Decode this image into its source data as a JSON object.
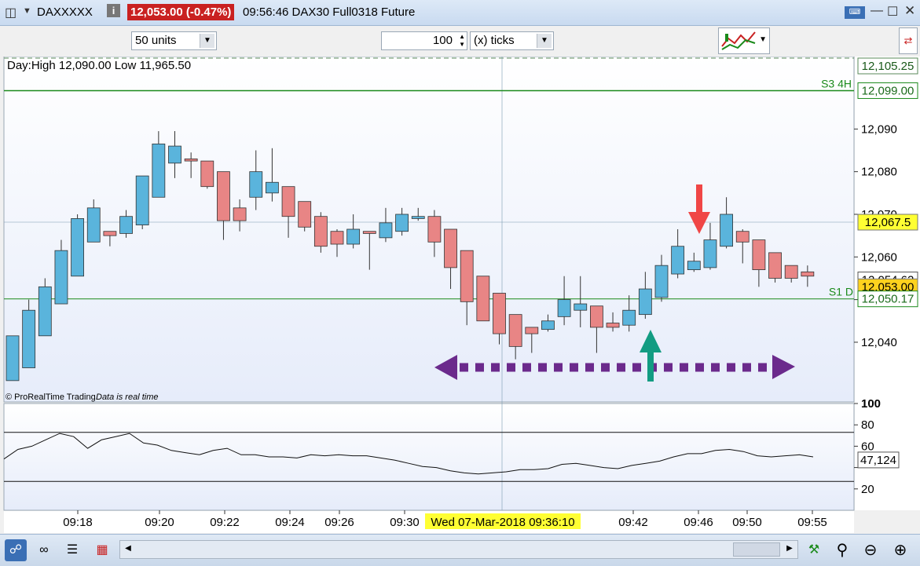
{
  "window": {
    "symbol": "DAXXXXX",
    "price_badge": "12,053.00 (-0.47%)",
    "info": "09:56:46 DAX30 Full0318 Future"
  },
  "toolbar": {
    "units_select": "50 units",
    "ticks_value": "100",
    "ticks_select": "(x) ticks"
  },
  "chart_data": [
    {
      "type": "candlestick",
      "title": "Day:High 12,090.00 Low 11,965.50",
      "footer_brand": "© ProRealTime Trading",
      "footer_note": "Data is real time",
      "ylim": [
        12026,
        12107
      ],
      "y_ticks": [
        12040,
        12050,
        12060,
        12070,
        12080,
        12090
      ],
      "y_tick_labels": [
        "12,040",
        "12,050",
        "12,060",
        "12,070",
        "12,080",
        "12,090"
      ],
      "x_tick_labels": [
        "09:18",
        "09:20",
        "09:22",
        "09:24",
        "09:26",
        "09:30",
        "09:42",
        "09:46",
        "09:50",
        "09:55"
      ],
      "crosshair_label": "Wed 07-Mar-2018 09:36:10",
      "crosshair_price": "12,067.5",
      "current_price": "12,053.00",
      "price_labels": [
        "12,105.25",
        "12,054.62",
        "12,050.17"
      ],
      "levels": [
        {
          "name": "S3 4H",
          "value": 12099.0,
          "label": "12,099.00",
          "color": "#1a8a1a"
        },
        {
          "name": "S1 D",
          "value": 12050.17,
          "label": "12,050.17",
          "color": "#1a8a1a"
        }
      ],
      "colors": {
        "up": "#5ab4dc",
        "down": "#e88585",
        "arrow_down": "#f04646",
        "arrow_up": "#129c82",
        "range": "#6b2a8c"
      },
      "candles": [
        {
          "o": 12031.0,
          "h": 12038.0,
          "l": 12031.0,
          "c": 12041.5
        },
        {
          "o": 12034.0,
          "h": 12050.0,
          "l": 12034.0,
          "c": 12047.5
        },
        {
          "o": 12041.5,
          "h": 12055.0,
          "l": 12041.5,
          "c": 12053.0
        },
        {
          "o": 12049.0,
          "h": 12064.0,
          "l": 12049.0,
          "c": 12061.5
        },
        {
          "o": 12055.5,
          "h": 12070.0,
          "l": 12055.5,
          "c": 12069.0
        },
        {
          "o": 12063.5,
          "h": 12073.5,
          "l": 12063.5,
          "c": 12071.5
        },
        {
          "o": 12066.0,
          "h": 12066.0,
          "l": 12062.5,
          "c": 12065.0
        },
        {
          "o": 12065.5,
          "h": 12071.0,
          "l": 12064.5,
          "c": 12069.5
        },
        {
          "o": 12067.5,
          "h": 12077.5,
          "l": 12066.5,
          "c": 12079.0
        },
        {
          "o": 12074.0,
          "h": 12089.5,
          "l": 12074.0,
          "c": 12086.5
        },
        {
          "o": 12082.0,
          "h": 12089.5,
          "l": 12078.5,
          "c": 12086.0
        },
        {
          "o": 12083.0,
          "h": 12084.5,
          "l": 12078.5,
          "c": 12082.5
        },
        {
          "o": 12082.5,
          "h": 12082.5,
          "l": 12076.0,
          "c": 12076.5
        },
        {
          "o": 12080.0,
          "h": 12080.0,
          "l": 12064.0,
          "c": 12068.5
        },
        {
          "o": 12071.5,
          "h": 12073.5,
          "l": 12066.0,
          "c": 12068.5
        },
        {
          "o": 12074.0,
          "h": 12085.0,
          "l": 12071.0,
          "c": 12080.0
        },
        {
          "o": 12075.0,
          "h": 12085.5,
          "l": 12073.0,
          "c": 12077.5
        },
        {
          "o": 12076.5,
          "h": 12076.5,
          "l": 12064.5,
          "c": 12069.5
        },
        {
          "o": 12073.0,
          "h": 12073.0,
          "l": 12066.0,
          "c": 12067.0
        },
        {
          "o": 12069.5,
          "h": 12070.5,
          "l": 12061.0,
          "c": 12062.5
        },
        {
          "o": 12066.0,
          "h": 12066.5,
          "l": 12060.0,
          "c": 12063.0
        },
        {
          "o": 12063.0,
          "h": 12070.0,
          "l": 12062.0,
          "c": 12066.5
        },
        {
          "o": 12066.0,
          "h": 12066.0,
          "l": 12057.0,
          "c": 12065.5
        },
        {
          "o": 12064.5,
          "h": 12071.5,
          "l": 12063.5,
          "c": 12068.0
        },
        {
          "o": 12066.0,
          "h": 12071.5,
          "l": 12065.0,
          "c": 12070.0
        },
        {
          "o": 12069.0,
          "h": 12071.5,
          "l": 12068.5,
          "c": 12069.5
        },
        {
          "o": 12069.5,
          "h": 12071.0,
          "l": 12060.0,
          "c": 12063.5
        },
        {
          "o": 12066.5,
          "h": 12066.5,
          "l": 12052.5,
          "c": 12057.5
        },
        {
          "o": 12061.5,
          "h": 12061.5,
          "l": 12044.0,
          "c": 12049.5
        },
        {
          "o": 12055.5,
          "h": 12055.5,
          "l": 12046.0,
          "c": 12045.0
        },
        {
          "o": 12051.5,
          "h": 12051.5,
          "l": 12039.5,
          "c": 12042.0
        },
        {
          "o": 12046.5,
          "h": 12046.5,
          "l": 12036.0,
          "c": 12039.0
        },
        {
          "o": 12043.5,
          "h": 12043.5,
          "l": 12037.5,
          "c": 12042.0
        },
        {
          "o": 12043.0,
          "h": 12046.5,
          "l": 12042.5,
          "c": 12045.0
        },
        {
          "o": 12046.0,
          "h": 12055.5,
          "l": 12044.0,
          "c": 12050.0
        },
        {
          "o": 12047.5,
          "h": 12055.5,
          "l": 12043.5,
          "c": 12049.0
        },
        {
          "o": 12048.5,
          "h": 12048.5,
          "l": 12037.5,
          "c": 12043.5
        },
        {
          "o": 12044.5,
          "h": 12047.0,
          "l": 12042.5,
          "c": 12043.5
        },
        {
          "o": 12044.0,
          "h": 12051.0,
          "l": 12042.5,
          "c": 12047.5
        },
        {
          "o": 12046.5,
          "h": 12056.5,
          "l": 12045.5,
          "c": 12052.5
        },
        {
          "o": 12050.5,
          "h": 12060.5,
          "l": 12049.5,
          "c": 12058.0
        },
        {
          "o": 12056.0,
          "h": 12066.5,
          "l": 12055.0,
          "c": 12062.5
        },
        {
          "o": 12057.0,
          "h": 12061.0,
          "l": 12056.5,
          "c": 12059.0
        },
        {
          "o": 12057.5,
          "h": 12068.0,
          "l": 12057.0,
          "c": 12064.0
        },
        {
          "o": 12062.5,
          "h": 12074.0,
          "l": 12062.0,
          "c": 12070.0
        },
        {
          "o": 12066.0,
          "h": 12066.5,
          "l": 12058.5,
          "c": 12063.5
        },
        {
          "o": 12064.0,
          "h": 12064.0,
          "l": 12053.0,
          "c": 12057.0
        },
        {
          "o": 12061.0,
          "h": 12061.0,
          "l": 12054.0,
          "c": 12055.0
        },
        {
          "o": 12058.0,
          "h": 12058.0,
          "l": 12054.0,
          "c": 12055.0
        },
        {
          "o": 12056.5,
          "h": 12058.0,
          "l": 12053.0,
          "c": 12055.5
        }
      ]
    },
    {
      "type": "line",
      "ylim": [
        0,
        100
      ],
      "y_ticks": [
        20,
        40,
        60,
        80,
        100
      ],
      "y_tick_labels": [
        "20",
        "",
        "60",
        "80",
        "100"
      ],
      "bands": [
        27,
        73
      ],
      "current_label": "47,124",
      "values": [
        48,
        57,
        60,
        66,
        72,
        69,
        58,
        66,
        69,
        72,
        63,
        61,
        56,
        54,
        52,
        56,
        58,
        52,
        52,
        50,
        50,
        49,
        52,
        51,
        52,
        51,
        51,
        49,
        47,
        44,
        41,
        40,
        37,
        35,
        34,
        35,
        36,
        38,
        38,
        39,
        43,
        44,
        42,
        40,
        39,
        42,
        44,
        46,
        50,
        53,
        53,
        56,
        57,
        55,
        51,
        50,
        51,
        52,
        50
      ]
    }
  ]
}
